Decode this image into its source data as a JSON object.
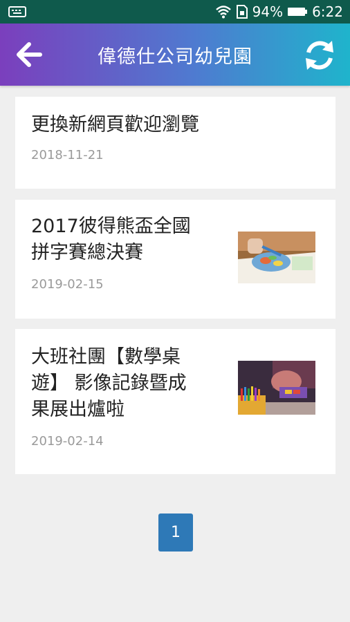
{
  "status_bar": {
    "battery_percent": "94%",
    "time": "6:22",
    "left_icon": "keyboard-icon",
    "wifi_icon": "wifi-icon",
    "sim_icon": "sim-card-icon",
    "battery_icon": "battery-icon",
    "color": "#0f5a4c"
  },
  "header": {
    "title": "偉德仕公司幼兒園",
    "back_icon": "arrow-left-icon",
    "refresh_icon": "refresh-icon",
    "gradient_colors": [
      "#7b3fbd",
      "#4f7ad0",
      "#1fb4cc"
    ]
  },
  "articles": [
    {
      "title": "更換新網頁歡迎瀏覽",
      "date": "2018-11-21",
      "has_thumbnail": false
    },
    {
      "title_lines": [
        "2017彼得熊盃全國",
        "拼字賽總決賽"
      ],
      "date": "2019-02-15",
      "has_thumbnail": true
    },
    {
      "title_lines": [
        "大班社團【數學桌",
        "遊】 影像記錄暨成",
        "果展出爐啦"
      ],
      "date": "2019-02-14",
      "has_thumbnail": true
    }
  ],
  "pagination": {
    "current_page": "1",
    "color": "#2e79b7"
  }
}
